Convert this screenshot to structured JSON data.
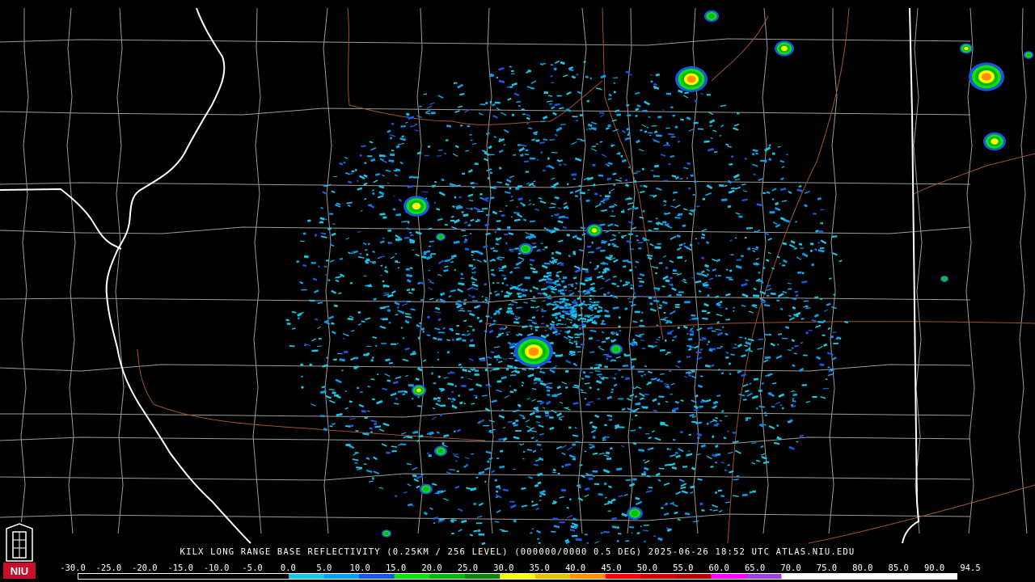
{
  "caption": "KILX LONG RANGE BASE REFLECTIVITY (0.25KM / 256 LEVEL) (000000/0000 0.5 DEG) 2025-06-26 18:52 UTC  ATLAS.NIU.EDU",
  "logo": {
    "text": "NIU",
    "icon": "university-tower-icon"
  },
  "legend": {
    "labels": [
      "-30.0",
      "-25.0",
      "-20.0",
      "-15.0",
      "-10.0",
      "-5.0",
      "0.0",
      "5.0",
      "10.0",
      "15.0",
      "20.0",
      "25.0",
      "30.0",
      "35.0",
      "40.0",
      "45.0",
      "50.0",
      "55.0",
      "60.0",
      "65.0",
      "70.0",
      "75.0",
      "80.0",
      "85.0",
      "90.0",
      "94.5"
    ],
    "colors": [
      "#000000",
      "#000000",
      "#000000",
      "#000000",
      "#000000",
      "#000000",
      "#18c8e8",
      "#0aa0f0",
      "#1a58e0",
      "#10e010",
      "#08b808",
      "#068a06",
      "#ffff00",
      "#e8c000",
      "#ff9000",
      "#ff0000",
      "#d00000",
      "#b00000",
      "#ff00ff",
      "#a040e0",
      "#ffffff",
      "#ffffff",
      "#ffffff",
      "#ffffff",
      "#ffffff"
    ]
  },
  "colors": {
    "background": "#000000",
    "county_lines": "#9a9a9a",
    "state_lines": "#ffffff",
    "highways": "#a0522d"
  }
}
